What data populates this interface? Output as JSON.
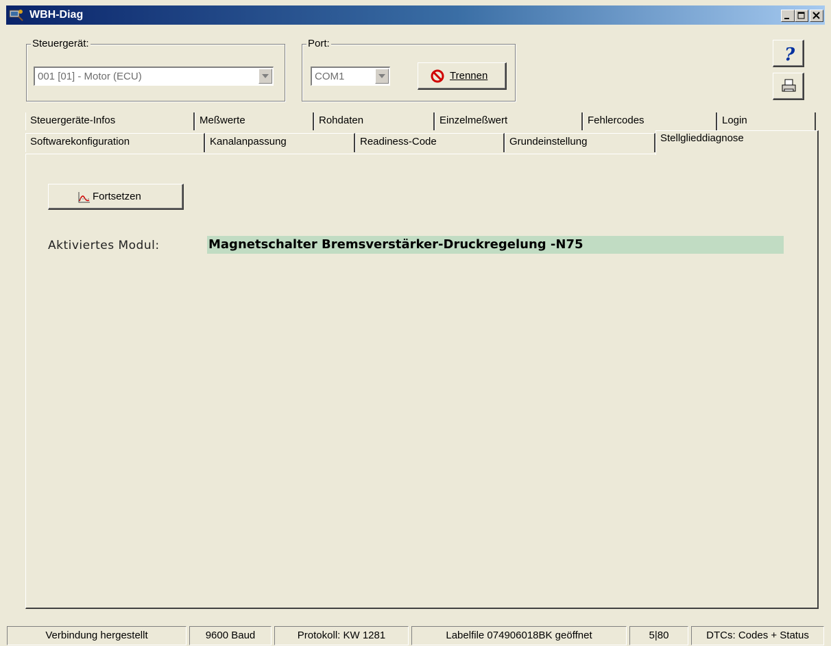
{
  "window": {
    "title": "WBH-Diag"
  },
  "controller": {
    "label": "Steuergerät:",
    "selected": "001 [01] - Motor (ECU)"
  },
  "port": {
    "label": "Port:",
    "selected": "COM1",
    "disconnect_label": "Trennen"
  },
  "tabs_row1": [
    "Steuergeräte-Infos",
    "Meßwerte",
    "Rohdaten",
    "Einzelmeßwert",
    "Fehlercodes",
    "Login"
  ],
  "tabs_row2": [
    "Softwarekonfiguration",
    "Kanalanpassung",
    "Readiness-Code",
    "Grundeinstellung",
    "Stellglieddiagnose"
  ],
  "panel": {
    "continue_label": "Fortsetzen",
    "module_label": "Aktiviertes Modul:",
    "module_value": "Magnetschalter Bremsverstärker-Druckregelung -N75"
  },
  "statusbar": {
    "connection": "Verbindung hergestellt",
    "baud": "9600 Baud",
    "protocol": "Protokoll: KW 1281",
    "labelfile": "Labelfile 074906018BK geöffnet",
    "counter": "5|80",
    "dtc_mode": "DTCs: Codes + Status"
  },
  "colors": {
    "module_highlight": "#c1dcc3",
    "titlebar": "#0a246a"
  }
}
